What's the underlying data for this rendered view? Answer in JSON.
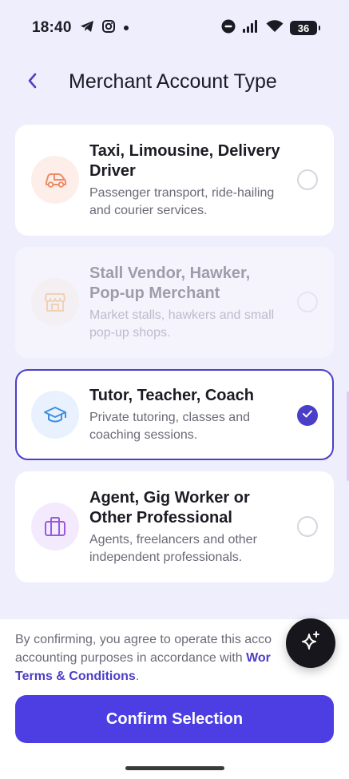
{
  "status_bar": {
    "time": "18:40",
    "battery": "36"
  },
  "header": {
    "title": "Merchant Account Type"
  },
  "options": [
    {
      "title": "Taxi, Limousine, Delivery Driver",
      "description": "Passenger transport, ride-hailing and courier services.",
      "icon": "car-icon",
      "state": "unselected"
    },
    {
      "title": "Stall Vendor, Hawker, Pop-up Merchant",
      "description": "Market stalls, hawkers and small pop-up shops.",
      "icon": "store-icon",
      "state": "disabled"
    },
    {
      "title": "Tutor, Teacher, Coach",
      "description": "Private tutoring, classes and coaching sessions.",
      "icon": "graduation-cap-icon",
      "state": "selected"
    },
    {
      "title": "Agent, Gig Worker or Other Professional",
      "description": "Agents, freelancers and other independent professionals.",
      "icon": "briefcase-icon",
      "state": "unselected"
    }
  ],
  "footer": {
    "terms_line1": "By confirming, you agree to operate this acco",
    "terms_line2_text": "accounting purposes in accordance with ",
    "terms_line2_link": "Wor",
    "terms_link2": "Terms & Conditions",
    "terms_end": ".",
    "confirm_label": "Confirm Selection"
  },
  "colors": {
    "accent": "#4b3fc7",
    "button": "#4d3ee3",
    "background": "#efeefd"
  }
}
